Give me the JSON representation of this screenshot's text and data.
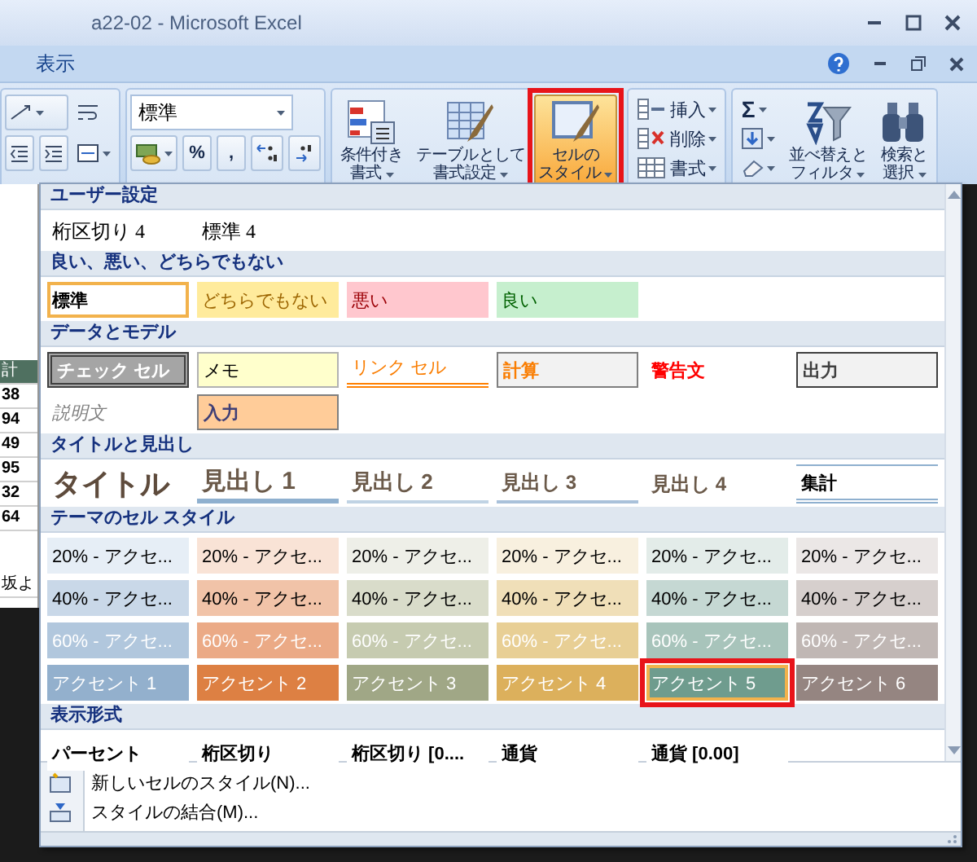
{
  "window": {
    "title": "a22-02 - Microsoft Excel"
  },
  "ribbon_tabs": [
    {
      "label": "表示"
    }
  ],
  "ribbon": {
    "number_format": {
      "value": "標準"
    },
    "number_buttons": [
      {
        "label": "%"
      },
      {
        "label": ","
      }
    ],
    "style_buttons": [
      {
        "lines": [
          "条件付き",
          "書式"
        ],
        "kind": "conditional",
        "pressed": false,
        "callout": false
      },
      {
        "lines": [
          "テーブルとして",
          "書式設定"
        ],
        "kind": "table",
        "pressed": false,
        "callout": false
      },
      {
        "lines": [
          "セルの",
          "スタイル"
        ],
        "kind": "cellstyle",
        "pressed": true,
        "callout": true
      }
    ],
    "cell_buttons": [
      {
        "label": "挿入",
        "kind": "insert"
      },
      {
        "label": "削除",
        "kind": "delete"
      },
      {
        "label": "書式",
        "kind": "format"
      }
    ],
    "sum_button": {
      "label": "Σ"
    },
    "edit_buttons": [
      {
        "lines": [
          "並べ替えと",
          "フィルタ"
        ],
        "kind": "sort"
      },
      {
        "lines": [
          "検索と",
          "選択"
        ],
        "kind": "find"
      }
    ]
  },
  "sheet": {
    "cells": [
      {
        "text": "計",
        "kind": "header"
      },
      {
        "text": "38",
        "kind": "number"
      },
      {
        "text": "94",
        "kind": "number"
      },
      {
        "text": "49",
        "kind": "number"
      },
      {
        "text": "95",
        "kind": "number"
      },
      {
        "text": "32",
        "kind": "number"
      },
      {
        "text": "64",
        "kind": "number"
      },
      {
        "text": "坂よ",
        "kind": "text"
      }
    ]
  },
  "cell_styles": {
    "sections": [
      {
        "title": "ユーザー設定",
        "items": [
          {
            "label": "桁区切り 4",
            "kind": "user",
            "selected": false,
            "callout": false
          },
          {
            "label": "標準 4",
            "kind": "user",
            "selected": false,
            "callout": false
          }
        ]
      },
      {
        "title": "良い、悪い、どちらでもない",
        "items": [
          {
            "label": "標準",
            "kind": "normal",
            "selected": true,
            "callout": false
          },
          {
            "label": "どちらでもない",
            "kind": "neutral",
            "selected": false,
            "callout": false
          },
          {
            "label": "悪い",
            "kind": "bad",
            "selected": false,
            "callout": false
          },
          {
            "label": "良い",
            "kind": "good",
            "selected": false,
            "callout": false
          }
        ]
      },
      {
        "title": "データとモデル",
        "items": [
          {
            "label": "チェック セル",
            "kind": "check",
            "selected": false,
            "callout": false
          },
          {
            "label": "メモ",
            "kind": "note",
            "selected": false,
            "callout": false
          },
          {
            "label": "リンク セル",
            "kind": "link",
            "selected": false,
            "callout": false
          },
          {
            "label": "計算",
            "kind": "calc",
            "selected": false,
            "callout": false
          },
          {
            "label": "警告文",
            "kind": "warning",
            "selected": false,
            "callout": false
          },
          {
            "label": "出力",
            "kind": "output",
            "selected": false,
            "callout": false
          },
          {
            "label": "説明文",
            "kind": "explanatory",
            "selected": false,
            "callout": false
          },
          {
            "label": "入力",
            "kind": "input",
            "selected": false,
            "callout": false
          }
        ]
      },
      {
        "title": "タイトルと見出し",
        "items": [
          {
            "label": "タイトル",
            "kind": "title",
            "selected": false,
            "callout": false
          },
          {
            "label": "見出し 1",
            "kind": "heading1",
            "selected": false,
            "callout": false
          },
          {
            "label": "見出し 2",
            "kind": "heading2",
            "selected": false,
            "callout": false
          },
          {
            "label": "見出し 3",
            "kind": "heading3",
            "selected": false,
            "callout": false
          },
          {
            "label": "見出し 4",
            "kind": "heading4",
            "selected": false,
            "callout": false
          },
          {
            "label": "集計",
            "kind": "total",
            "selected": false,
            "callout": false
          }
        ]
      },
      {
        "title": "テーマのセル スタイル",
        "items": [
          {
            "label": "20% - アクセ...",
            "kind": "tint",
            "color": "#e6eef6",
            "selected": false,
            "callout": false
          },
          {
            "label": "20% - アクセ...",
            "kind": "tint",
            "color": "#f9e3d6",
            "selected": false,
            "callout": false
          },
          {
            "label": "20% - アクセ...",
            "kind": "tint",
            "color": "#eeefe8",
            "selected": false,
            "callout": false
          },
          {
            "label": "20% - アクセ...",
            "kind": "tint",
            "color": "#f8f0df",
            "selected": false,
            "callout": false
          },
          {
            "label": "20% - アクセ...",
            "kind": "tint",
            "color": "#e3ece9",
            "selected": false,
            "callout": false
          },
          {
            "label": "20% - アクセ...",
            "kind": "tint",
            "color": "#ebe7e6",
            "selected": false,
            "callout": false
          },
          {
            "label": "40% - アクセ...",
            "kind": "tint",
            "color": "#c9d8e8",
            "selected": false,
            "callout": false
          },
          {
            "label": "40% - アクセ...",
            "kind": "tint",
            "color": "#f1c3a8",
            "selected": false,
            "callout": false
          },
          {
            "label": "40% - アクセ...",
            "kind": "tint",
            "color": "#d9dcca",
            "selected": false,
            "callout": false
          },
          {
            "label": "40% - アクセ...",
            "kind": "tint",
            "color": "#f0dfb8",
            "selected": false,
            "callout": false
          },
          {
            "label": "40% - アクセ...",
            "kind": "tint",
            "color": "#c5d8d3",
            "selected": false,
            "callout": false
          },
          {
            "label": "40% - アクセ...",
            "kind": "tint",
            "color": "#d6cfcd",
            "selected": false,
            "callout": false
          },
          {
            "label": "60% - アクセ...",
            "kind": "shade",
            "color": "#b1c7dd",
            "selected": false,
            "callout": false
          },
          {
            "label": "60% - アクセ...",
            "kind": "shade",
            "color": "#ebaa86",
            "selected": false,
            "callout": false
          },
          {
            "label": "60% - アクセ...",
            "kind": "shade",
            "color": "#c6cbb0",
            "selected": false,
            "callout": false
          },
          {
            "label": "60% - アクセ...",
            "kind": "shade",
            "color": "#e8cf95",
            "selected": false,
            "callout": false
          },
          {
            "label": "60% - アクセ...",
            "kind": "shade",
            "color": "#a8c4bb",
            "selected": false,
            "callout": false
          },
          {
            "label": "60% - アクセ...",
            "kind": "shade",
            "color": "#c0b7b4",
            "selected": false,
            "callout": false
          },
          {
            "label": "アクセント 1",
            "kind": "shade",
            "color": "#93b0cd",
            "selected": false,
            "callout": false
          },
          {
            "label": "アクセント 2",
            "kind": "shade",
            "color": "#dd8043",
            "selected": false,
            "callout": false
          },
          {
            "label": "アクセント 3",
            "kind": "shade",
            "color": "#a0a786",
            "selected": false,
            "callout": false
          },
          {
            "label": "アクセント 4",
            "kind": "shade",
            "color": "#dcb05c",
            "selected": false,
            "callout": false
          },
          {
            "label": "アクセント 5",
            "kind": "shade",
            "color": "#6f9c8e",
            "selected": true,
            "callout": true
          },
          {
            "label": "アクセント 6",
            "kind": "shade",
            "color": "#958581",
            "selected": false,
            "callout": false
          }
        ]
      },
      {
        "title": "表示形式",
        "items": [
          {
            "label": "パーセント",
            "kind": "format",
            "selected": false,
            "callout": false
          },
          {
            "label": "桁区切り",
            "kind": "format",
            "selected": false,
            "callout": false
          },
          {
            "label": "桁区切り [0....",
            "kind": "format",
            "selected": false,
            "callout": false
          },
          {
            "label": "通貨",
            "kind": "format",
            "selected": false,
            "callout": false
          },
          {
            "label": "通貨 [0.00]",
            "kind": "format",
            "selected": false,
            "callout": false
          }
        ]
      }
    ],
    "commands": [
      {
        "label": "新しいセルのスタイル(N)...",
        "kind": "new"
      },
      {
        "label": "スタイルの結合(M)...",
        "kind": "merge"
      }
    ]
  }
}
